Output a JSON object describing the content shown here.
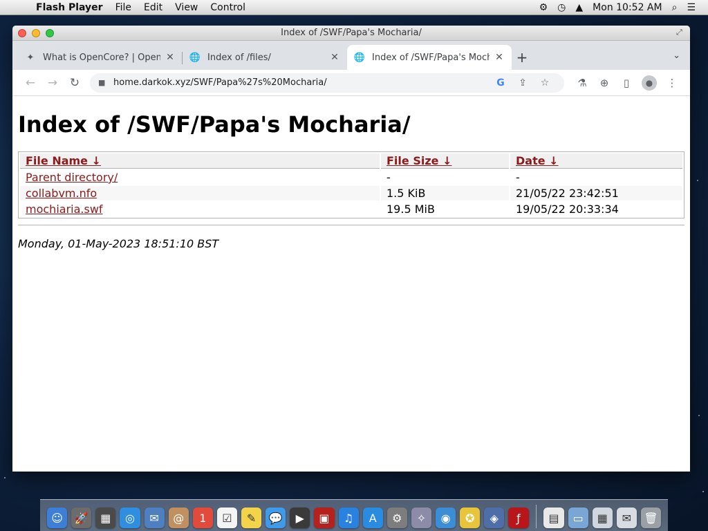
{
  "menubar": {
    "apple": "",
    "app_name": "Flash Player",
    "menus": [
      "File",
      "Edit",
      "View",
      "Control"
    ],
    "status_icons": [
      "⚙",
      "◷",
      "▲"
    ],
    "clock": "Mon 10:52 AM",
    "search": "⌕",
    "list": "☰"
  },
  "window": {
    "title": "Index of /SWF/Papa's Mocharia/"
  },
  "tabs": [
    {
      "label": "What is OpenCore? | OpenCor",
      "icon": "✦",
      "close": "✕"
    },
    {
      "label": "Index of /files/",
      "icon": "🌐",
      "close": "✕"
    },
    {
      "label": "Index of /SWF/Papa's Mochar",
      "icon": "🌐",
      "close": "✕"
    }
  ],
  "new_tab": "+",
  "tab_menu": "⌄",
  "toolbar": {
    "back": "←",
    "forward": "→",
    "reload": "↻",
    "lock": "🔒",
    "url": "home.darkok.xyz/SWF/Papa%27s%20Mocharia/",
    "google": "G",
    "share": "⇪",
    "star": "☆",
    "ext": "⚗",
    "download": "⊕",
    "sidepanel": "▯",
    "profile": "●",
    "more": "⋮"
  },
  "page": {
    "heading": "Index of /SWF/Papa's Mocharia/",
    "columns": [
      "File Name  ↓",
      "File Size  ↓",
      "Date  ↓"
    ],
    "rows": [
      {
        "name": "Parent directory/",
        "size": "-",
        "date": "-"
      },
      {
        "name": "collabvm.nfo",
        "size": "1.5 KiB",
        "date": "21/05/22 23:42:51"
      },
      {
        "name": "mochiaria.swf",
        "size": "19.5 MiB",
        "date": "19/05/22 20:33:34"
      }
    ],
    "timestamp": "Monday, 01-May-2023 18:51:10 BST"
  },
  "dock": {
    "items": [
      {
        "name": "finder",
        "glyph": "☺",
        "color": "#3d7fd6"
      },
      {
        "name": "launchpad",
        "glyph": "🚀",
        "color": "#6c6c6c"
      },
      {
        "name": "mission-control",
        "glyph": "▦",
        "color": "#4a4a4a"
      },
      {
        "name": "safari",
        "glyph": "◎",
        "color": "#2f8ee0"
      },
      {
        "name": "mail",
        "glyph": "✉",
        "color": "#4e7fbf"
      },
      {
        "name": "contacts",
        "glyph": "@",
        "color": "#c09060"
      },
      {
        "name": "calendar",
        "glyph": "1",
        "color": "#e24a3b"
      },
      {
        "name": "reminders",
        "glyph": "☑",
        "color": "#f4f4f4"
      },
      {
        "name": "notes",
        "glyph": "✎",
        "color": "#f2d34a"
      },
      {
        "name": "messages",
        "glyph": "💬",
        "color": "#3d9be9"
      },
      {
        "name": "facetime",
        "glyph": "▶",
        "color": "#3a3a3a"
      },
      {
        "name": "photo-booth",
        "glyph": "▣",
        "color": "#b5211c"
      },
      {
        "name": "itunes",
        "glyph": "♫",
        "color": "#2a82e0"
      },
      {
        "name": "app-store",
        "glyph": "A",
        "color": "#2a8ce0"
      },
      {
        "name": "system-preferences",
        "glyph": "⚙",
        "color": "#7d7d7d"
      },
      {
        "name": "wizard",
        "glyph": "✧",
        "color": "#8c8ca8"
      },
      {
        "name": "quicktime",
        "glyph": "◉",
        "color": "#3b8ed6"
      },
      {
        "name": "cyberduck",
        "glyph": "✪",
        "color": "#e8c43a"
      },
      {
        "name": "virtualbox",
        "glyph": "◈",
        "color": "#4f6ea8"
      },
      {
        "name": "flash-player",
        "glyph": "ƒ",
        "color": "#b8161a"
      }
    ],
    "right_items": [
      {
        "name": "document",
        "glyph": "▤",
        "color": "#e8e8e8"
      },
      {
        "name": "desktop-folder",
        "glyph": "▭",
        "color": "#7aa6d6"
      },
      {
        "name": "screenshot",
        "glyph": "▦",
        "color": "#cfd6df"
      },
      {
        "name": "mail-folder",
        "glyph": "✉",
        "color": "#d8dde4"
      },
      {
        "name": "trash",
        "glyph": "🗑",
        "color": "#9aa0a6"
      }
    ]
  }
}
